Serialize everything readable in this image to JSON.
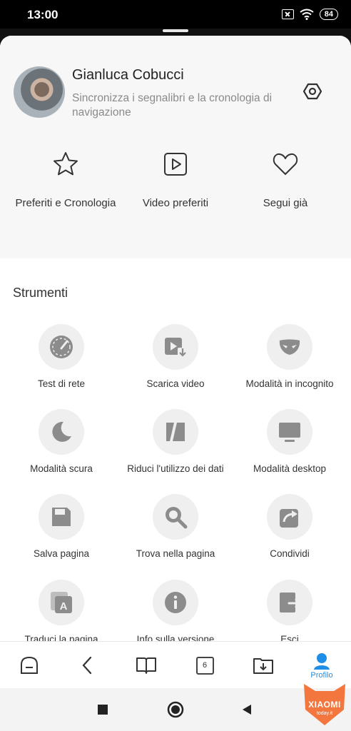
{
  "status_bar": {
    "time": "13:00",
    "battery": "84"
  },
  "profile": {
    "name": "Gianluca Cobucci",
    "subtitle": "Sincronizza i segnalibri e la cronologia di navigazione"
  },
  "quick_actions": [
    {
      "label": "Preferiti e Cronologia",
      "icon": "star-icon"
    },
    {
      "label": "Video preferiti",
      "icon": "play-video-icon"
    },
    {
      "label": "Segui già",
      "icon": "heart-icon"
    }
  ],
  "tools_title": "Strumenti",
  "tools": [
    {
      "label": "Test di rete",
      "icon": "speedometer-icon"
    },
    {
      "label": "Scarica video",
      "icon": "download-video-icon"
    },
    {
      "label": "Modalità in incognito",
      "icon": "mask-icon"
    },
    {
      "label": "Modalità scura",
      "icon": "moon-icon"
    },
    {
      "label": "Riduci l'utilizzo dei dati",
      "icon": "data-saver-icon"
    },
    {
      "label": "Modalità desktop",
      "icon": "monitor-icon"
    },
    {
      "label": "Salva pagina",
      "icon": "save-page-icon"
    },
    {
      "label": "Trova nella pagina",
      "icon": "find-icon"
    },
    {
      "label": "Condividi",
      "icon": "share-icon"
    },
    {
      "label": "Traduci la pagina",
      "icon": "translate-icon"
    },
    {
      "label": "Info sulla versione",
      "icon": "info-icon"
    },
    {
      "label": "Esci",
      "icon": "exit-icon"
    }
  ],
  "bottom_nav": {
    "tab_count": "6",
    "profile_label": "Profilo"
  },
  "watermark": {
    "brand": "XIAOMI",
    "site": "today.it"
  },
  "colors": {
    "accent": "#1f8ee6",
    "icon_gray": "#8c8c8c",
    "circle_bg": "#efefef"
  }
}
